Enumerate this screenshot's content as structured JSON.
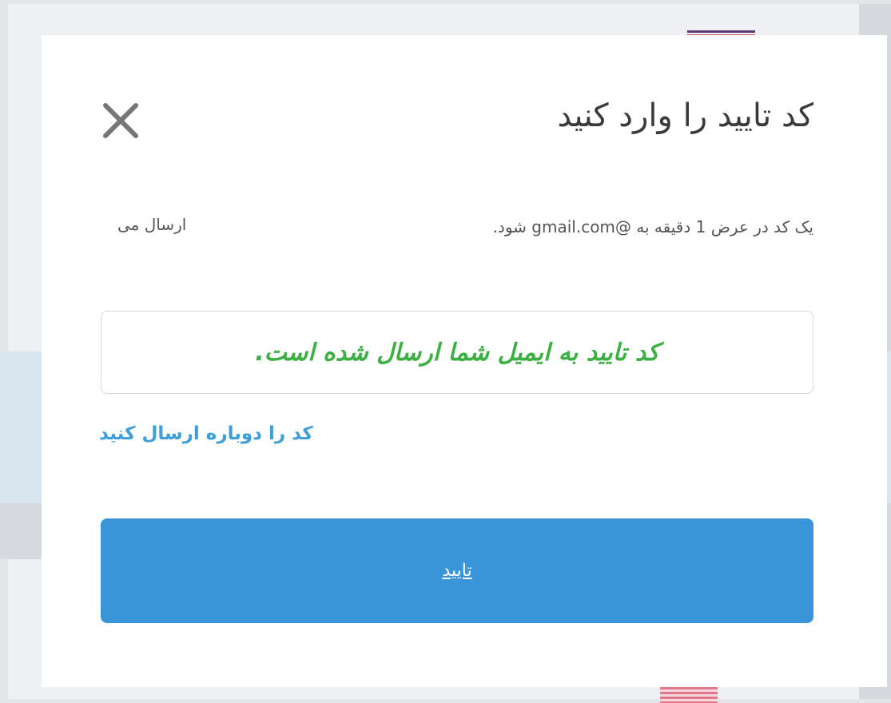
{
  "modal": {
    "title": "کد تایید را وارد کنید",
    "close_icon": "close-icon",
    "info_text": "یک کد در عرض 1 دقیقه به @gmail.com شود.",
    "info_suffix": "ارسال می",
    "code_input": {
      "value": "کد تایید به ایمیل شما ارسال شده است."
    },
    "resend_link": "کد را دوباره ارسال کنید",
    "confirm_button": "تایید"
  },
  "colors": {
    "primary": "#3995d8",
    "link": "#3d9ed9",
    "success_text": "#3cb043",
    "close_icon": "#777777"
  }
}
